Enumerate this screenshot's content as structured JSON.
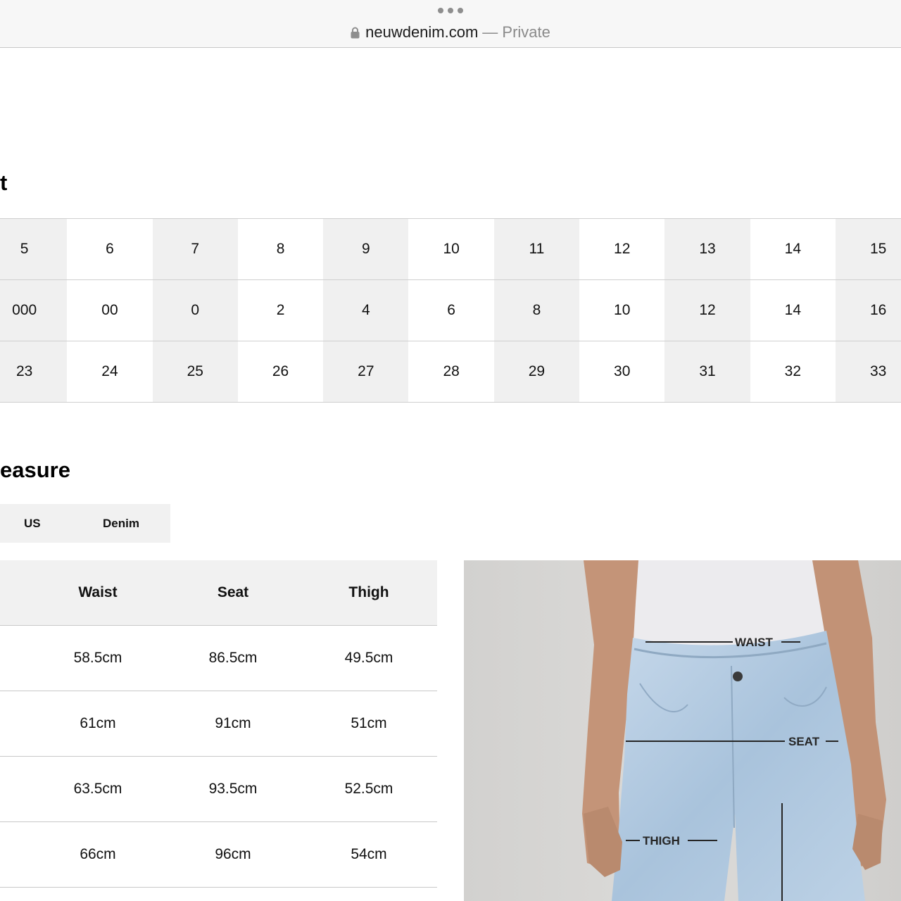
{
  "browser": {
    "domain": "neuwdenim.com",
    "private_label": "— Private"
  },
  "size_chart": {
    "heading": "t",
    "rows": [
      [
        "5",
        "6",
        "7",
        "8",
        "9",
        "10",
        "11",
        "12",
        "13",
        "14",
        "15"
      ],
      [
        "000",
        "00",
        "0",
        "2",
        "4",
        "6",
        "8",
        "10",
        "12",
        "14",
        "16"
      ],
      [
        "23",
        "24",
        "25",
        "26",
        "27",
        "28",
        "29",
        "30",
        "31",
        "32",
        "33"
      ]
    ]
  },
  "measure": {
    "heading": "easure",
    "tabs": [
      {
        "label": "US"
      },
      {
        "label": "Denim"
      }
    ],
    "table": {
      "headers": {
        "waist": "Waist",
        "seat": "Seat",
        "thigh": "Thigh"
      },
      "rows": [
        {
          "waist": "58.5cm",
          "seat": "86.5cm",
          "thigh": "49.5cm"
        },
        {
          "waist": "61cm",
          "seat": "91cm",
          "thigh": "51cm"
        },
        {
          "waist": "63.5cm",
          "seat": "93.5cm",
          "thigh": "52.5cm"
        },
        {
          "waist": "66cm",
          "seat": "96cm",
          "thigh": "54cm"
        }
      ]
    }
  },
  "photo": {
    "labels": {
      "waist": "WAIST",
      "seat": "SEAT",
      "thigh": "THIGH"
    }
  },
  "colors": {
    "shade": "#f0f0f0",
    "denim": "#b9cfe3",
    "top": "#ecebee",
    "skin": "#c99a7d"
  }
}
